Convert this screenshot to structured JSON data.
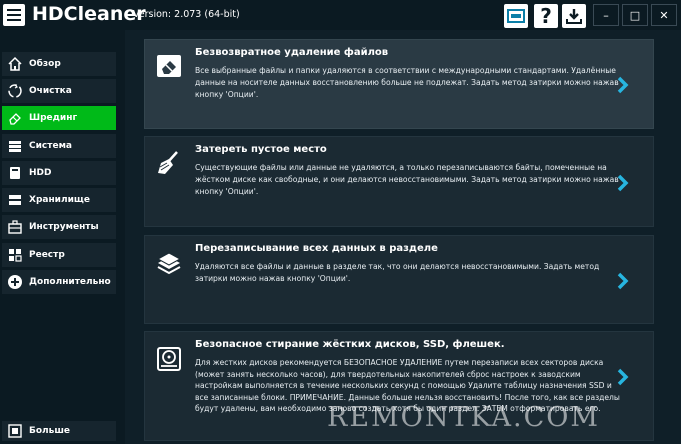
{
  "app": {
    "title": "HDCleaner",
    "version": "Version: 2.073 (64-bit)"
  },
  "window": {
    "minimize_label": "–",
    "maximize_label": "□",
    "close_label": "✕"
  },
  "toolbar": {
    "help_label": "?"
  },
  "sidebar": {
    "items": [
      {
        "label": "Обзор",
        "icon": "home-icon"
      },
      {
        "label": "Очистка",
        "icon": "recycle-icon"
      },
      {
        "label": "Шрединг",
        "icon": "eraser-icon"
      },
      {
        "label": "Система",
        "icon": "system-icon"
      },
      {
        "label": "HDD",
        "icon": "hdd-icon"
      },
      {
        "label": "Хранилище",
        "icon": "storage-icon"
      },
      {
        "label": "Инструменты",
        "icon": "toolbox-icon"
      },
      {
        "label": "Реестр",
        "icon": "registry-icon"
      },
      {
        "label": "Дополнительно",
        "icon": "plus-icon"
      }
    ],
    "more_label": "Больше"
  },
  "cards": [
    {
      "title": "Безвозвратное удаление файлов",
      "description": "Все выбранные файлы и папки удаляются в соответствии с международными стандартами. Удалённые данные на носителе данных восстановлению больше не подлежат. Задать метод затирки можно нажав кнопку 'Опции'."
    },
    {
      "title": "Затереть пустое место",
      "description": "Существующие файлы или данные не удаляются, а только перезаписываются байты, помеченные на жёстком диске как свободные, и они делаются невосстановимыми. Задать метод затирки можно нажав кнопку 'Опции'."
    },
    {
      "title": "Перезаписывание всех данных в разделе",
      "description": "Удаляются все файлы и данные в разделе так, что они делаются невосстановимыми. Задать метод затирки можно нажав кнопку 'Опции'."
    },
    {
      "title": "Безопасное стирание жёстких дисков, SSD, флешек.",
      "description": "Для жестких дисков рекомендуется БЕЗОПАСНОЕ УДАЛЕНИЕ путем перезаписи всех секторов диска (может занять несколько часов), для твердотельных накопителей сброс настроек к заводским настройкам выполняется в течение нескольких секунд с помощью Удалите таблицу назначения SSD и все записанные блоки. ПРИМЕЧАНИЕ. Данные больше нельзя восстановить! После того, как все разделы будут удалены, вам необходимо заново создать хотя бы один раздел. ЗАТЕМ отформатировать его."
    }
  ],
  "watermark": "REMONTKA.COM",
  "colors": {
    "accent": "#00ba18",
    "chevron": "#27b5e0",
    "background": "#0b1a22"
  }
}
